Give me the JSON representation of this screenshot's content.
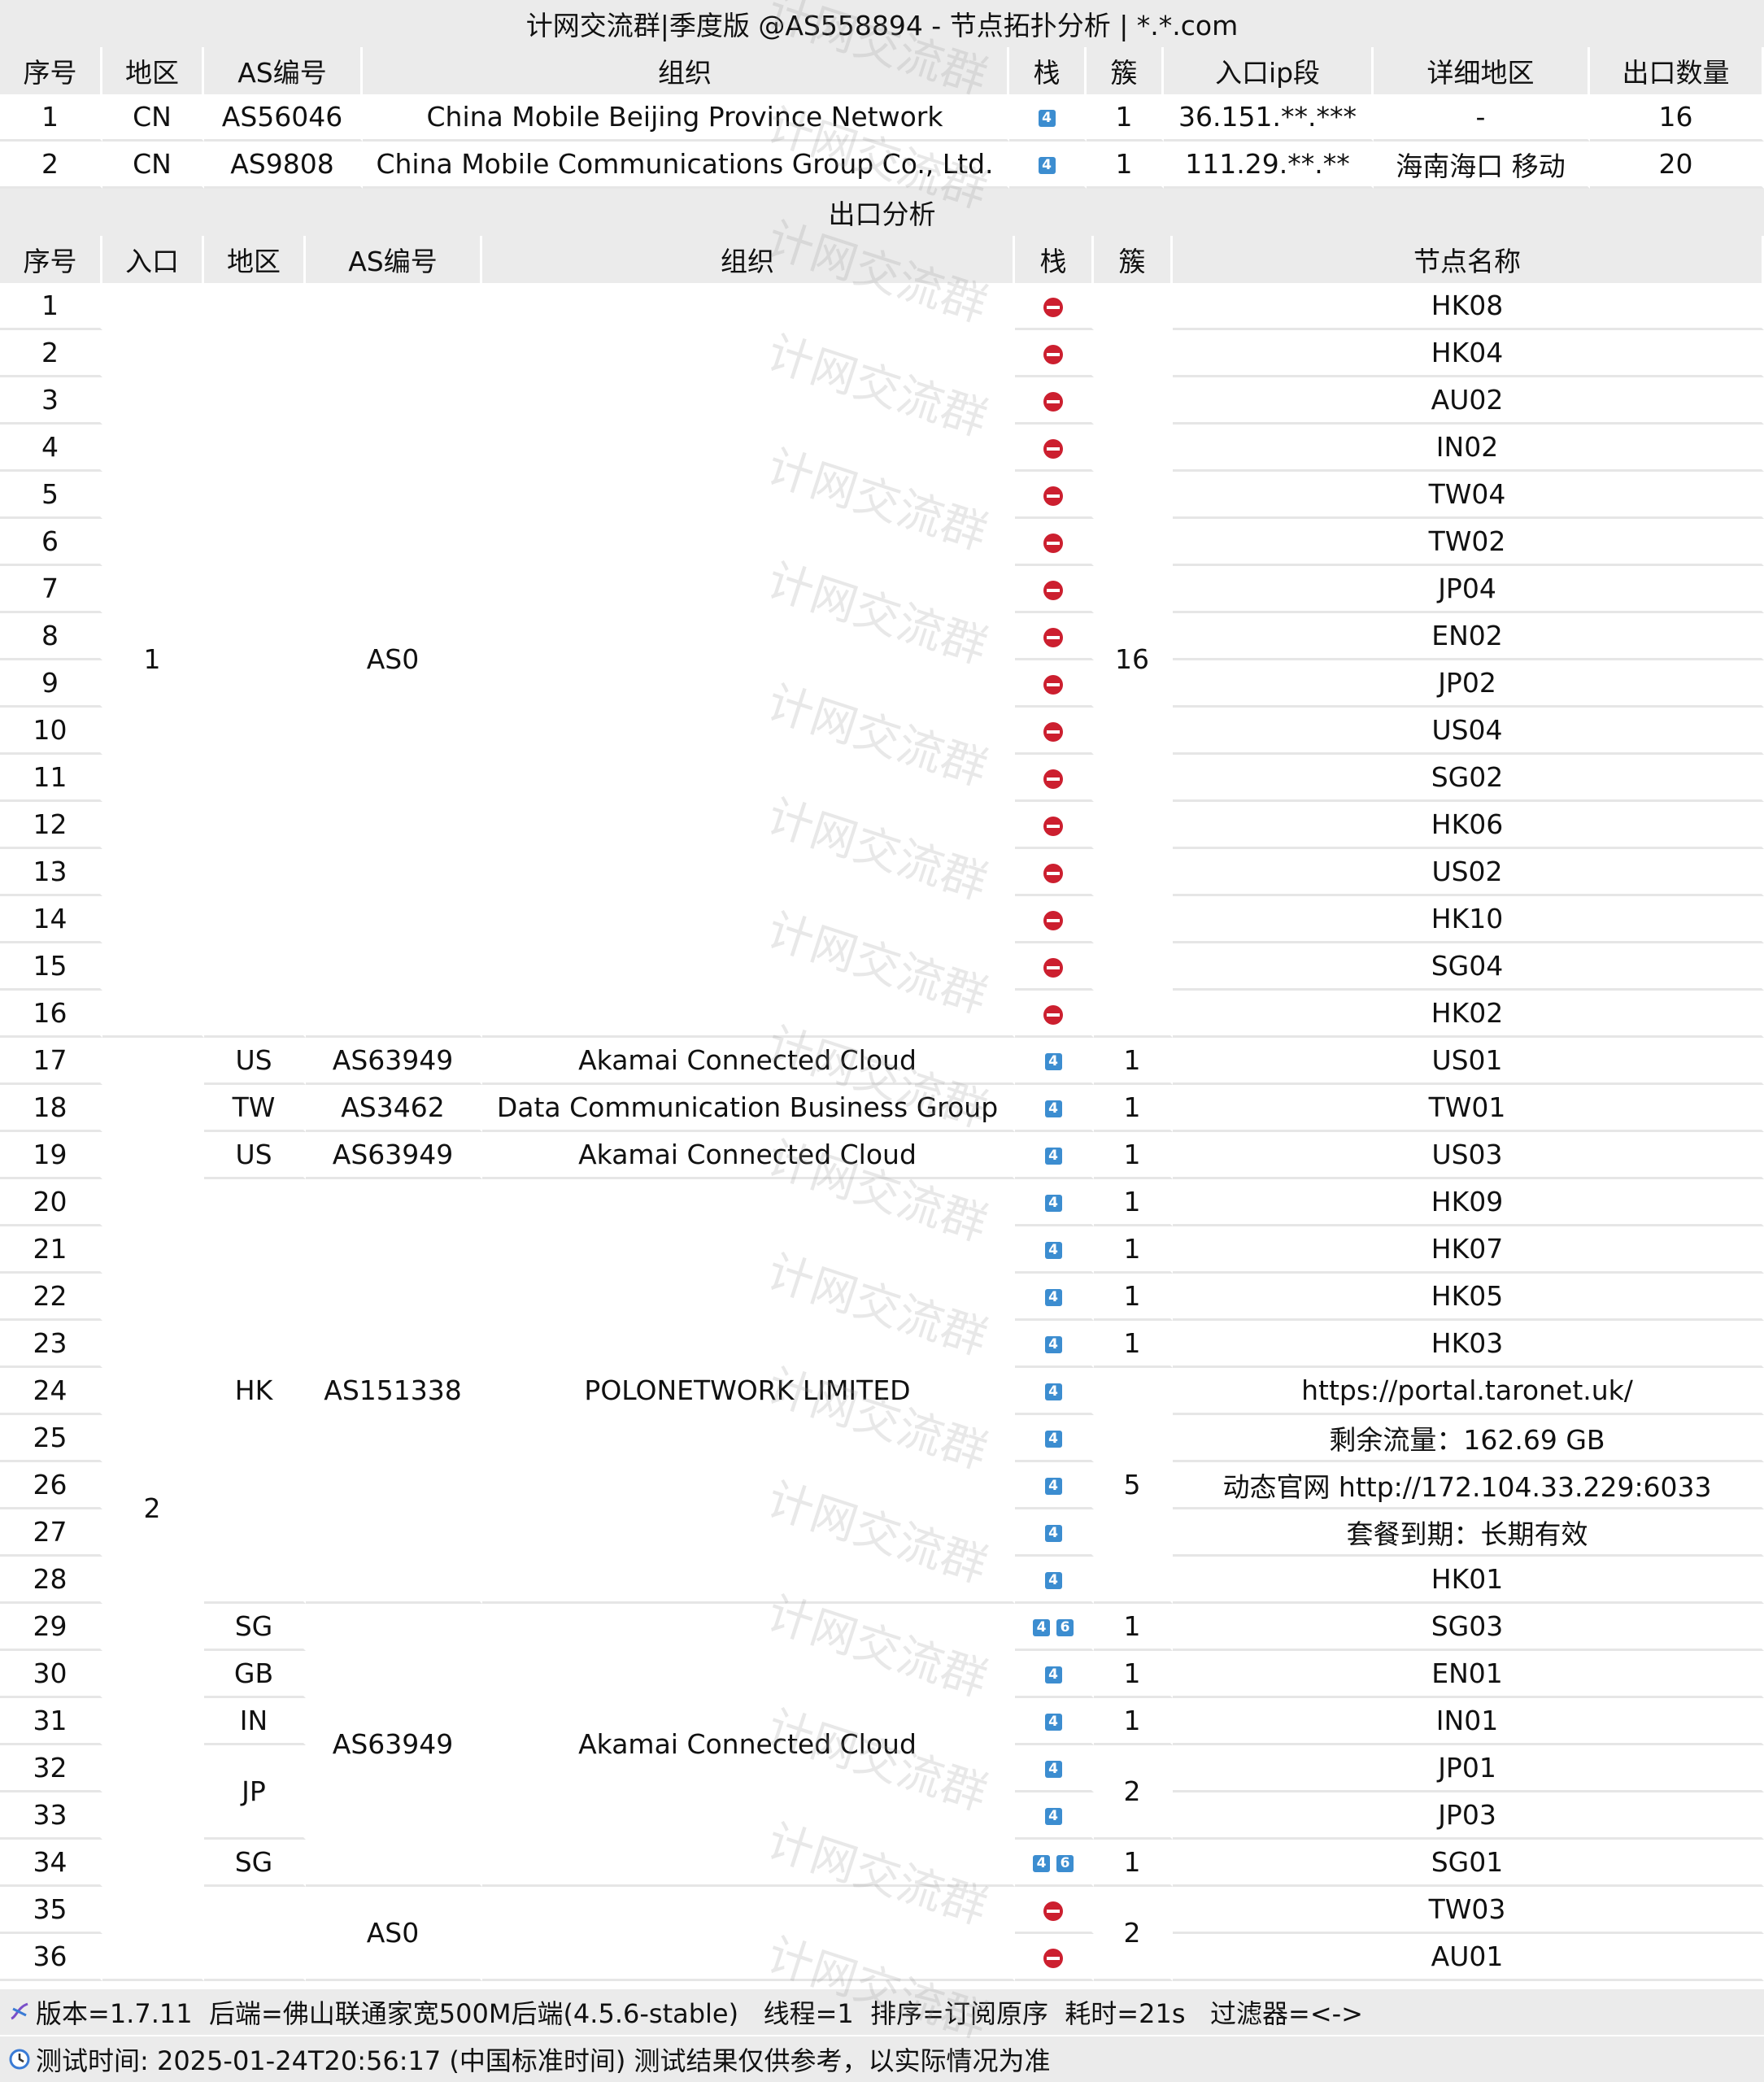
{
  "title": "计网交流群|季度版 @AS558894 - 节点拓扑分析 | *.*.com",
  "watermark": "计网交流群",
  "entry_table": {
    "headers": [
      "序号",
      "地区",
      "AS编号",
      "组织",
      "栈",
      "簇",
      "入口ip段",
      "详细地区",
      "出口数量"
    ],
    "rows": [
      {
        "seq": "1",
        "region": "CN",
        "asn": "AS56046",
        "org": "China Mobile Beijing Province Network",
        "stack": "4",
        "cluster": "1",
        "ip": "36.151.**.***",
        "detail": "-",
        "count": "16"
      },
      {
        "seq": "2",
        "region": "CN",
        "asn": "AS9808",
        "org": "China Mobile Communications Group Co., Ltd.",
        "stack": "4",
        "cluster": "1",
        "ip": "111.29.**.**",
        "detail": "海南海口 移动",
        "count": "20"
      }
    ]
  },
  "exit_section_title": "出口分析",
  "exit_table": {
    "headers": [
      "序号",
      "入口",
      "地区",
      "AS编号",
      "组织",
      "栈",
      "簇",
      "节点名称"
    ],
    "groups": {
      "entry1": "1",
      "entry2": "2",
      "as0_asn": "AS0",
      "as0_cluster": "16",
      "us": "US",
      "tw": "TW",
      "hk": "HK",
      "sg": "SG",
      "gb": "GB",
      "in": "IN",
      "jp": "JP",
      "akamai_asn": "AS63949",
      "akamai_org": "Akamai Connected Cloud",
      "tw_asn": "AS3462",
      "tw_org": "Data Communication Business Group",
      "polo_asn": "AS151338",
      "polo_org": "POLONETWORK LIMITED",
      "one": "1",
      "two": "2",
      "five": "5",
      "as0b_asn": "AS0"
    },
    "seq": [
      "1",
      "2",
      "3",
      "4",
      "5",
      "6",
      "7",
      "8",
      "9",
      "10",
      "11",
      "12",
      "13",
      "14",
      "15",
      "16",
      "17",
      "18",
      "19",
      "20",
      "21",
      "22",
      "23",
      "24",
      "25",
      "26",
      "27",
      "28",
      "29",
      "30",
      "31",
      "32",
      "33",
      "34",
      "35",
      "36"
    ],
    "nodes": [
      "HK08",
      "HK04",
      "AU02",
      "IN02",
      "TW04",
      "TW02",
      "JP04",
      "EN02",
      "JP02",
      "US04",
      "SG02",
      "HK06",
      "US02",
      "HK10",
      "SG04",
      "HK02",
      "US01",
      "TW01",
      "US03",
      "HK09",
      "HK07",
      "HK05",
      "HK03",
      "https://portal.taronet.uk/",
      "剩余流量：162.69 GB",
      "动态官网 http://172.104.33.229:6033",
      "套餐到期：长期有效",
      "HK01",
      "SG03",
      "EN01",
      "IN01",
      "JP01",
      "JP03",
      "SG01",
      "TW03",
      "AU01"
    ],
    "stack_labels": {
      "v4": "4",
      "v6": "6"
    }
  },
  "footer": {
    "line1": "版本=1.7.11  后端=佛山联通家宽500M后端(4.5.6-stable)   线程=1  排序=订阅原序  耗时=21s   过滤器=<->",
    "line2": "测试时间: 2025-01-24T20:56:17 (中国标准时间)  测试结果仅供参考，以实际情况为准"
  }
}
